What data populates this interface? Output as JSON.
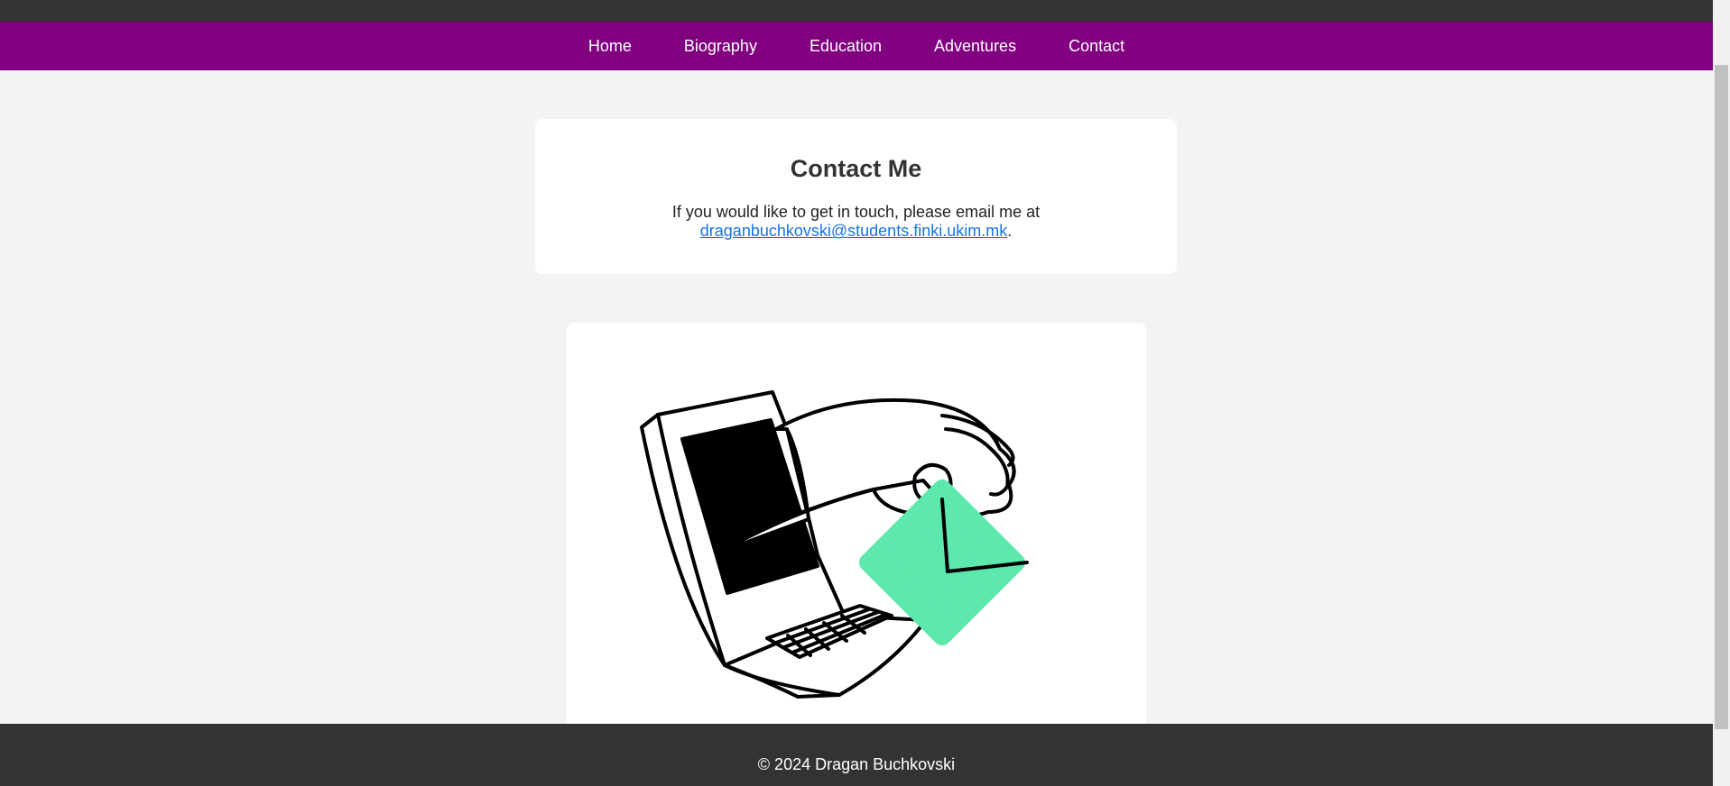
{
  "nav": {
    "items": [
      "Home",
      "Biography",
      "Education",
      "Adventures",
      "Contact"
    ]
  },
  "contact": {
    "title": "Contact Me",
    "text_before": "If you would like to get in touch, please email me at ",
    "email": "draganbuchkovski@students.finki.ukim.mk",
    "text_after": "."
  },
  "illustration": {
    "description_icon": "laptop-hand-envelope-illustration",
    "envelope_color": "#5ef0b0"
  },
  "footer": {
    "text": "© 2024 Dragan Buchkovski"
  },
  "colors": {
    "nav_background": "#800080",
    "topbar_background": "#333333",
    "footer_background": "#333333",
    "link": "#1a73e8"
  }
}
